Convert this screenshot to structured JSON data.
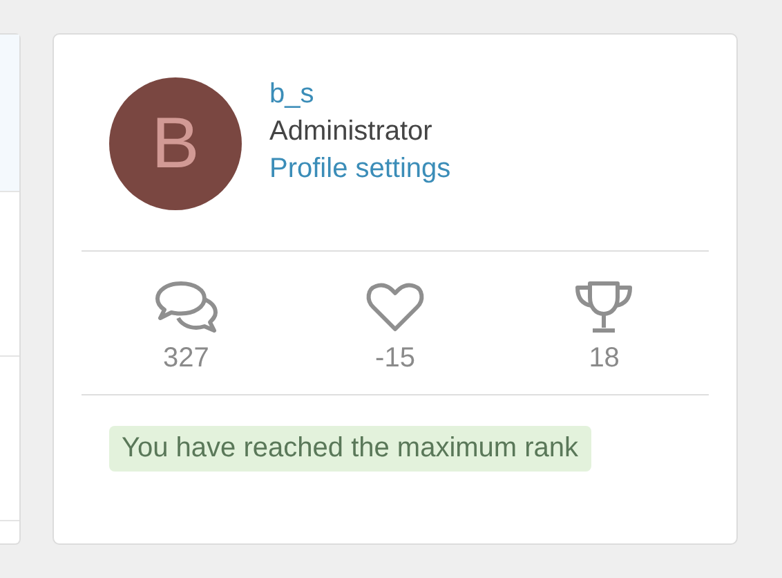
{
  "user": {
    "avatar_letter": "B",
    "name": "b_s",
    "role": "Administrator",
    "profile_link": "Profile settings"
  },
  "stats": [
    {
      "kind": "messages",
      "value": "327"
    },
    {
      "kind": "reactions",
      "value": "-15"
    },
    {
      "kind": "trophies",
      "value": "18"
    }
  ],
  "rank_notice": "You have reached the maximum rank"
}
